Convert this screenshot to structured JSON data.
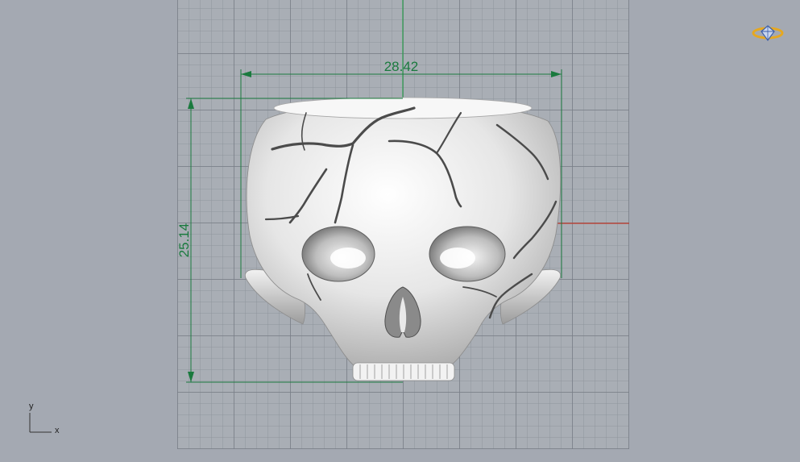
{
  "viewport": {
    "dimensions": {
      "width_value": "28.42",
      "height_value": "25.14"
    },
    "axes": {
      "y_label": "y",
      "x_label": "x"
    },
    "colors": {
      "background": "#a4a9b2",
      "grid_line": "#787d87",
      "dimension": "#1a7a3e",
      "x_axis": "#c0392b",
      "y_axis": "#2e9e4f",
      "model": "#e8e8e8"
    },
    "logo_icon": "gem-ring-icon"
  }
}
